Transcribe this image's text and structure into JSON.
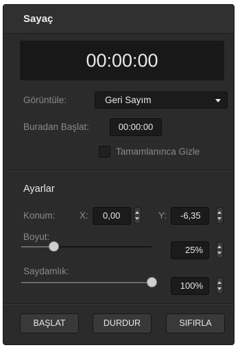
{
  "panel": {
    "title": "Sayaç"
  },
  "timer": {
    "display": "00:00:00"
  },
  "display_mode": {
    "label": "Görüntüle:",
    "selected": "Geri Sayım"
  },
  "start_from": {
    "label": "Buradan Başlat:",
    "value": "00:00:00"
  },
  "hide_on_complete": {
    "label": "Tamamlanınca Gizle",
    "checked": false
  },
  "settings": {
    "title": "Ayarlar",
    "position": {
      "label": "Konum:",
      "x_label": "X:",
      "x_value": "0,00",
      "y_label": "Y:",
      "y_value": "-6,35"
    },
    "size": {
      "label": "Boyut:",
      "value": "25%",
      "level": 0.25
    },
    "opacity": {
      "label": "Saydamlık:",
      "value": "100%",
      "level": 1.0
    }
  },
  "buttons": {
    "start": "BAŞLAT",
    "stop": "DURDUR",
    "reset": "SIFIRLA"
  },
  "colors": {
    "panel_bg": "#2b2b2b",
    "field_bg": "#1b1b1b",
    "text": "#e8e8e8",
    "label": "#8a8a8a"
  }
}
